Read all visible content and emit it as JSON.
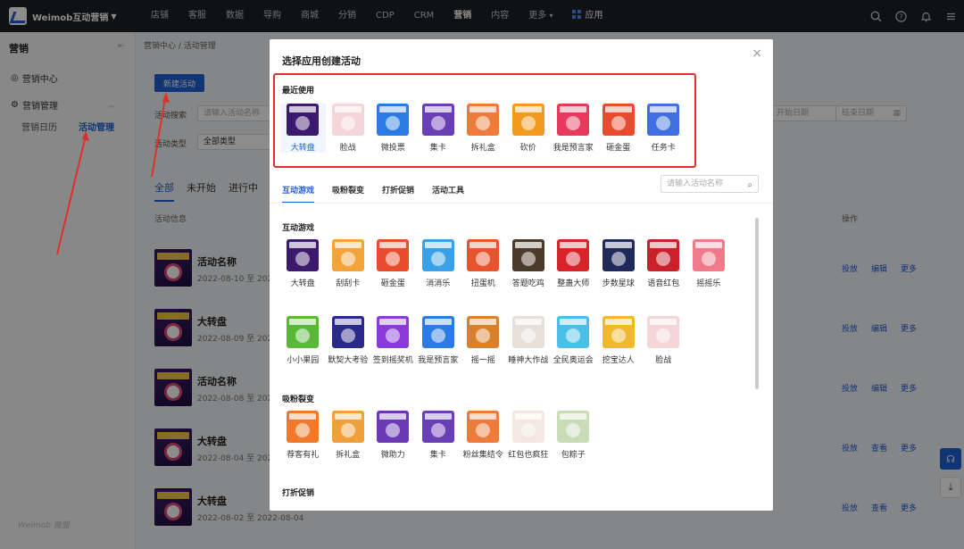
{
  "topbar": {
    "brand": "Weimob互动营销",
    "nav": [
      "店铺",
      "客服",
      "数据",
      "导购",
      "商城",
      "分销",
      "CDP",
      "CRM",
      "营销",
      "内容",
      "更多"
    ],
    "active_nav": "营销",
    "app_label": "应用"
  },
  "sidebar": {
    "title": "营销",
    "item_center": "营销中心",
    "item_manage": "营销管理",
    "sub_calendar": "营销日历",
    "sub_activity": "活动管理",
    "footer": "Weimob 微盟"
  },
  "main": {
    "breadcrumb": "营销中心 / 活动管理",
    "new_button": "新建活动",
    "search_label": "活动搜索",
    "search_placeholder": "请输入活动名称",
    "type_label": "活动类型",
    "type_value": "全部类型",
    "start_date": "开始日期",
    "end_date": "结束日期",
    "tabs": [
      "全部",
      "未开始",
      "进行中"
    ],
    "col_info": "活动信息",
    "col_op": "操作",
    "rows": [
      {
        "name": "活动名称",
        "date": "2022-08-10 至 2022-08",
        "a1": "投放",
        "a2": "编辑",
        "a3": "更多"
      },
      {
        "name": "大转盘",
        "date": "2022-08-09 至 2022-08",
        "a1": "投放",
        "a2": "编辑",
        "a3": "更多"
      },
      {
        "name": "活动名称",
        "date": "2022-08-08 至 2022-08",
        "a1": "投放",
        "a2": "编辑",
        "a3": "更多"
      },
      {
        "name": "大转盘",
        "date": "2022-08-04 至 2022-08",
        "a1": "投放",
        "a2": "查看",
        "a3": "更多"
      },
      {
        "name": "大转盘",
        "date": "2022-08-02 至 2022-08-04",
        "a1": "投放",
        "a2": "查看",
        "a3": "更多"
      }
    ]
  },
  "modal": {
    "title": "选择应用创建活动",
    "recent_title": "最近使用",
    "recent": [
      {
        "label": "大转盘",
        "color": "#3b1a6e"
      },
      {
        "label": "脸战",
        "color": "#f4d6d8"
      },
      {
        "label": "微投票",
        "color": "#2c7be5"
      },
      {
        "label": "集卡",
        "color": "#6a3fb5"
      },
      {
        "label": "拆礼盒",
        "color": "#f07a3a"
      },
      {
        "label": "砍价",
        "color": "#f39a1e"
      },
      {
        "label": "我是预言家",
        "color": "#e8395d"
      },
      {
        "label": "砸金蛋",
        "color": "#e84c2c"
      },
      {
        "label": "任务卡",
        "color": "#3f6fe0"
      }
    ],
    "tabs": [
      "互动游戏",
      "吸粉裂变",
      "打折促销",
      "活动工具"
    ],
    "search_placeholder": "请输入活动名称",
    "sec1_title": "互动游戏",
    "games_row1": [
      {
        "label": "大转盘",
        "color": "#3b1a6e"
      },
      {
        "label": "刮刮卡",
        "color": "#f4a23a"
      },
      {
        "label": "砸金蛋",
        "color": "#e84c2c"
      },
      {
        "label": "消消乐",
        "color": "#3aa0e8"
      },
      {
        "label": "扭蛋机",
        "color": "#e8532c"
      },
      {
        "label": "答题吃鸡",
        "color": "#4a3a2a"
      },
      {
        "label": "整蛊大师",
        "color": "#d8232a"
      },
      {
        "label": "步数星球",
        "color": "#1f2a5a"
      },
      {
        "label": "语音红包",
        "color": "#c9202a"
      },
      {
        "label": "摇摇乐",
        "color": "#f07a8a"
      }
    ],
    "games_row2": [
      {
        "label": "小小果园",
        "color": "#5ab838"
      },
      {
        "label": "默契大考验",
        "color": "#2a2a8a"
      },
      {
        "label": "签到摇奖机",
        "color": "#8a3ad8"
      },
      {
        "label": "我是预言家",
        "color": "#2c7be5"
      },
      {
        "label": "摇一摇",
        "color": "#d8802a"
      },
      {
        "label": "睡神大作战",
        "color": "#e8e0d8"
      },
      {
        "label": "全民奥运会",
        "color": "#4ac0e8"
      },
      {
        "label": "挖宝达人",
        "color": "#f0b82a"
      },
      {
        "label": "脸战",
        "color": "#f4d6d8"
      }
    ],
    "sec2_title": "吸粉裂变",
    "fission": [
      {
        "label": "荐客有礼",
        "color": "#f07a2a"
      },
      {
        "label": "拆礼盒",
        "color": "#f0a03a"
      },
      {
        "label": "微助力",
        "color": "#6a3ab5"
      },
      {
        "label": "集卡",
        "color": "#6a3fb5"
      },
      {
        "label": "粉丝集结令",
        "color": "#f07a3a"
      },
      {
        "label": "红包也疯狂",
        "color": "#f4e6e0"
      },
      {
        "label": "包粽子",
        "color": "#c8dcb8"
      }
    ],
    "sec3_title": "打折促销"
  }
}
